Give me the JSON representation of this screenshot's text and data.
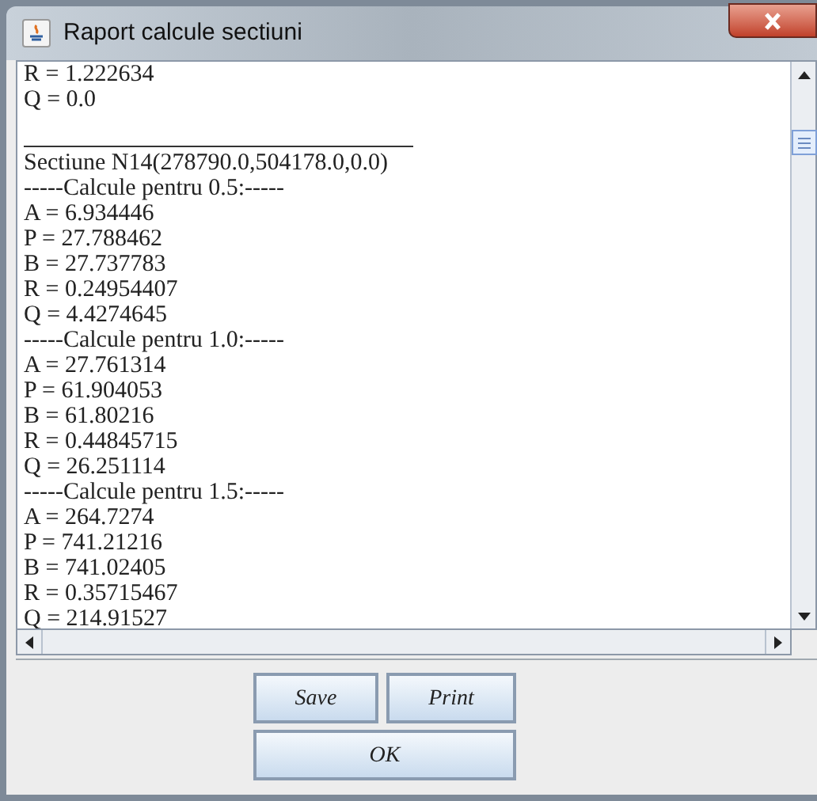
{
  "window": {
    "title": "Raport calcule sectiuni"
  },
  "report_lines": [
    {
      "kind": "text",
      "text": "R = 1.222634"
    },
    {
      "kind": "text",
      "text": "Q = 0.0"
    },
    {
      "kind": "rule"
    },
    {
      "kind": "text",
      "text": "Sectiune N14(278790.0,504178.0,0.0)"
    },
    {
      "kind": "text",
      "text": "-----Calcule pentru 0.5:-----"
    },
    {
      "kind": "text",
      "text": "A = 6.934446"
    },
    {
      "kind": "text",
      "text": "P = 27.788462"
    },
    {
      "kind": "text",
      "text": "B = 27.737783"
    },
    {
      "kind": "text",
      "text": "R = 0.24954407"
    },
    {
      "kind": "text",
      "text": "Q = 4.4274645"
    },
    {
      "kind": "text",
      "text": "-----Calcule pentru 1.0:-----"
    },
    {
      "kind": "text",
      "text": "A = 27.761314"
    },
    {
      "kind": "text",
      "text": "P = 61.904053"
    },
    {
      "kind": "text",
      "text": "B = 61.80216"
    },
    {
      "kind": "text",
      "text": "R = 0.44845715"
    },
    {
      "kind": "text",
      "text": "Q = 26.251114"
    },
    {
      "kind": "text",
      "text": "-----Calcule pentru 1.5:-----"
    },
    {
      "kind": "text",
      "text": "A = 264.7274"
    },
    {
      "kind": "text",
      "text": "P = 741.21216"
    },
    {
      "kind": "text",
      "text": "B = 741.02405"
    },
    {
      "kind": "text",
      "text": "R = 0.35715467"
    },
    {
      "kind": "text",
      "text": "Q = 214.91527"
    }
  ],
  "buttons": [
    {
      "label": "Save"
    },
    {
      "label": "Print"
    },
    {
      "label": "OK"
    }
  ]
}
